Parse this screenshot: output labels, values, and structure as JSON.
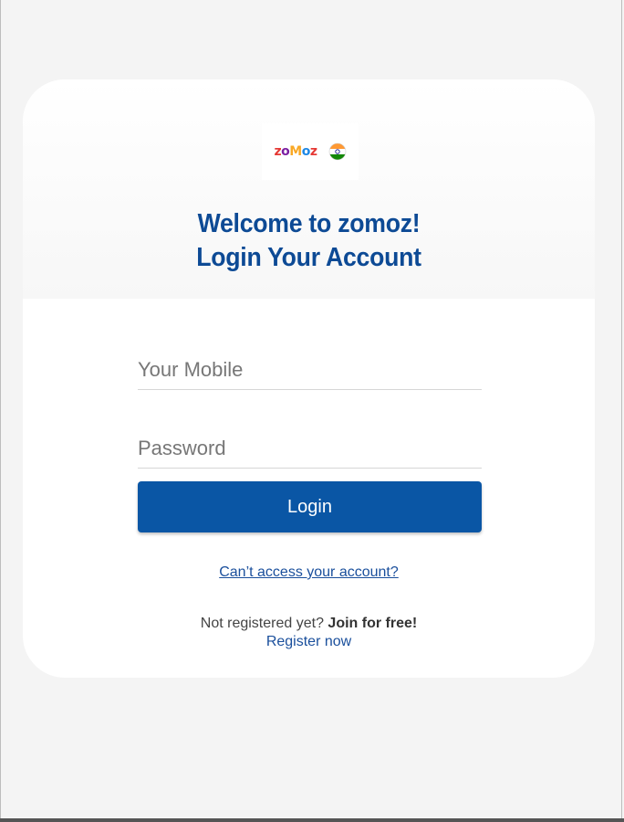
{
  "brand": {
    "logo_letters": [
      "z",
      "o",
      "M",
      "o",
      "z"
    ],
    "flag_icon": "india-flag-icon",
    "colors": {
      "primary": "#0d4a95",
      "button": "#0a56a5",
      "link": "#1a4f9c"
    }
  },
  "header": {
    "title_line1": "Welcome to zomoz!",
    "title_line2": "Login Your Account"
  },
  "form": {
    "mobile_placeholder": "Your Mobile",
    "mobile_value": "",
    "password_placeholder": "Password",
    "password_value": "",
    "login_label": "Login"
  },
  "links": {
    "forgot": "Can’t access your account?",
    "not_registered": "Not registered yet?",
    "join": "Join for free!",
    "register": "Register now"
  }
}
